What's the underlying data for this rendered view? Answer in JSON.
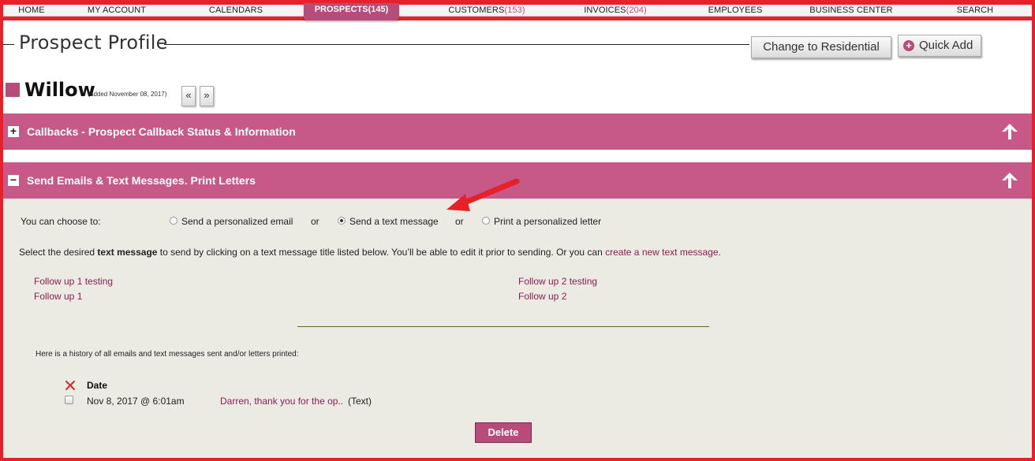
{
  "nav": {
    "items": [
      {
        "label": "HOME",
        "count": ""
      },
      {
        "label": "MY ACCOUNT",
        "count": ""
      },
      {
        "label": "CALENDARS",
        "count": ""
      },
      {
        "label": "PROSPECTS",
        "count": "(145)"
      },
      {
        "label": "CUSTOMERS",
        "count": "(153)"
      },
      {
        "label": "INVOICES",
        "count": "(204)"
      },
      {
        "label": "EMPLOYEES",
        "count": ""
      },
      {
        "label": "BUSINESS CENTER",
        "count": ""
      },
      {
        "label": "SEARCH",
        "count": ""
      }
    ],
    "active_index": 3
  },
  "page": {
    "title": "Prospect Profile",
    "change_button": "Change to Residential",
    "quick_add_button": "Quick Add",
    "quick_add_icon": "plus-circle-icon"
  },
  "prospect": {
    "name": "Willow",
    "added": "* (added November 08, 2017)",
    "prev_label": "«",
    "next_label": "»"
  },
  "sections": {
    "callbacks": {
      "toggle": "+",
      "title": "Callbacks - Prospect Callback Status & Information"
    },
    "messages": {
      "toggle": "−",
      "title": "Send Emails & Text Messages. Print Letters"
    }
  },
  "messages": {
    "choose_label": "You can choose to:",
    "options": [
      {
        "label": "Send a personalized email",
        "selected": false
      },
      {
        "label": "Send a text message",
        "selected": true
      },
      {
        "label": "Print a personalized letter",
        "selected": false
      }
    ],
    "or_text": "or",
    "instructions_pre": "Select the desired ",
    "instructions_bold": "text message",
    "instructions_mid": " to send by clicking on a text message title listed below. You’ll be able to edit it prior to sending. Or you can ",
    "instructions_link": "create a new text message",
    "instructions_end": ".",
    "templates_left": [
      "Follow up 1 testing",
      "Follow up 1"
    ],
    "templates_right": [
      "Follow up 2 testing",
      "Follow up 2"
    ],
    "history_intro": "Here is a history of all emails and text messages sent and/or letters printed:",
    "history_header": "Date",
    "history": [
      {
        "date": "Nov 8, 2017 @ 6:01am",
        "subject": "Darren, thank you for the op..",
        "type": "(Text)"
      }
    ],
    "delete_button": "Delete"
  },
  "colors": {
    "brand": "#c65987",
    "frame": "#e8202a",
    "link": "#8a1f52",
    "panel": "#ebebe4"
  }
}
